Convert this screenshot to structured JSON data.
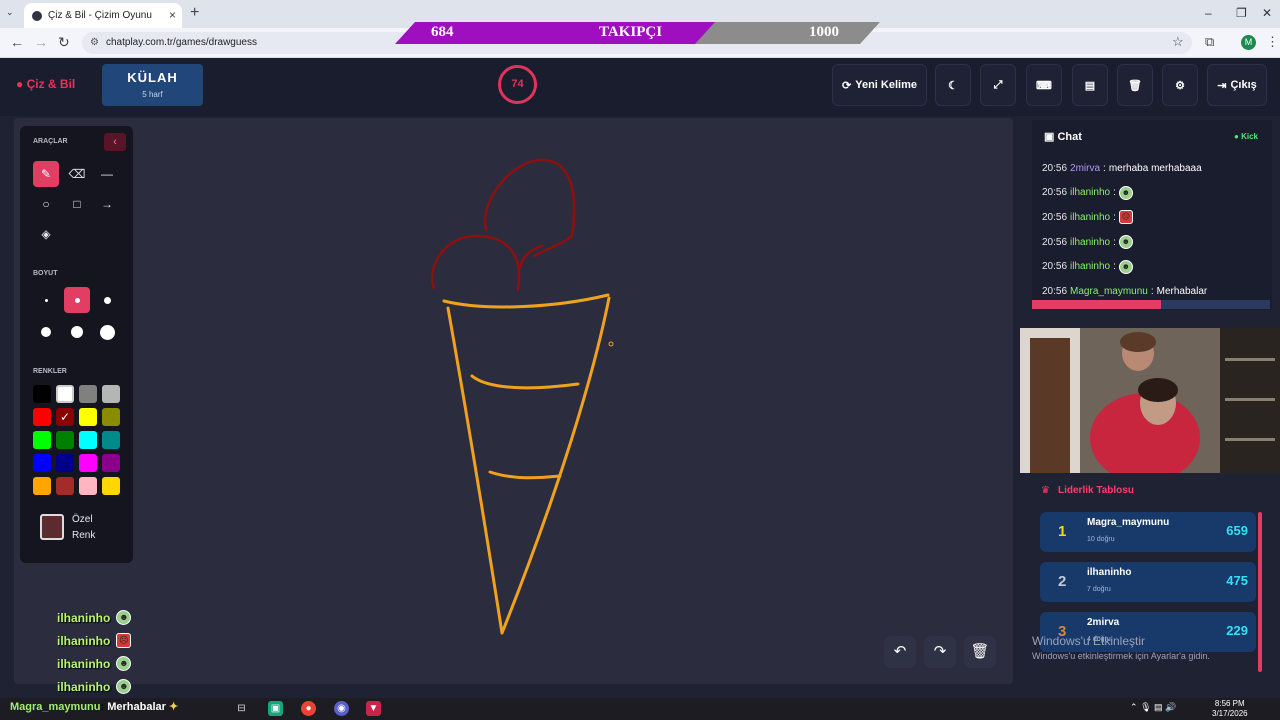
{
  "browser": {
    "tab_title": "Çiz & Bil - Çizim Oyunu",
    "url": "chatplay.com.tr/games/drawguess",
    "profile_initial": "M"
  },
  "follower_banner": {
    "current": "684",
    "label": "TAKIPÇI",
    "goal": "1000"
  },
  "header": {
    "brand": "Çiz & Bil",
    "word": "KÜLAH",
    "word_hint": "5 harf",
    "timer": "74",
    "new_word_label": "Yeni Kelime",
    "exit_label": "Çıkış"
  },
  "tools": {
    "title": "ARAÇLAR",
    "size_title": "BOYUT",
    "colors_title": "RENKLER",
    "custom_color_label_1": "Özel",
    "custom_color_label_2": "Renk",
    "custom_color": "#5c2b30",
    "swatches": [
      "#000000",
      "#ffffff",
      "#808080",
      "#b5b5b5",
      "#ff0000",
      "#8b0000",
      "#ffff00",
      "#8b8b00",
      "#00ff00",
      "#008000",
      "#00ffff",
      "#008b8b",
      "#0000ff",
      "#00008b",
      "#ff00ff",
      "#8b008b",
      "#ffa500",
      "#a52a2a",
      "#ffb6c1",
      "#ffd700"
    ],
    "selected_swatch": 5,
    "selected_size": 1
  },
  "overlay_chat": [
    {
      "name": "ilhaninho",
      "emoji": "☻"
    },
    {
      "name": "ilhaninho",
      "emoji": "☹"
    },
    {
      "name": "ilhaninho",
      "emoji": "☻"
    },
    {
      "name": "ilhaninho",
      "emoji": "☻"
    }
  ],
  "chat": {
    "title": "Chat",
    "platform": "Kick",
    "messages": [
      {
        "time": "20:56",
        "user": "2mirva",
        "text": "merhaba merhabaaa",
        "user_class": "u1",
        "emoji": ""
      },
      {
        "time": "20:56",
        "user": "ilhaninho",
        "text": "",
        "user_class": "u2",
        "emoji": "☻"
      },
      {
        "time": "20:56",
        "user": "ilhaninho",
        "text": "",
        "user_class": "u2",
        "emoji": "☹"
      },
      {
        "time": "20:56",
        "user": "ilhaninho",
        "text": "",
        "user_class": "u2",
        "emoji": "☻"
      },
      {
        "time": "20:56",
        "user": "ilhaninho",
        "text": "",
        "user_class": "u2",
        "emoji": "☻"
      },
      {
        "time": "20:56",
        "user": "Magra_maymunu",
        "text": "Merhabalar",
        "user_class": "u2",
        "emoji": ""
      }
    ],
    "progress": 0.54
  },
  "leaderboard": {
    "title": "Liderlik Tablosu",
    "rows": [
      {
        "rank": "1",
        "name": "Magra_maymunu",
        "sub": "10 doğru",
        "score": "659",
        "rank_color": "#ffd700"
      },
      {
        "rank": "2",
        "name": "ilhaninho",
        "sub": "7 doğru",
        "score": "475",
        "rank_color": "#c0c8d8"
      },
      {
        "rank": "3",
        "name": "2mirva",
        "sub": "4 doğru",
        "score": "229",
        "rank_color": "#d08a3c"
      }
    ]
  },
  "watermark": {
    "line1": "Windows'u Etkinleştir",
    "line2": "Windows'u etkinleştirmek için Ayarlar'a gidin."
  },
  "taskbar": {
    "chat_name": "Magra_maymunu",
    "chat_msg": "Merhabalar",
    "time": "8:56 PM",
    "date": "3/17/2026"
  }
}
